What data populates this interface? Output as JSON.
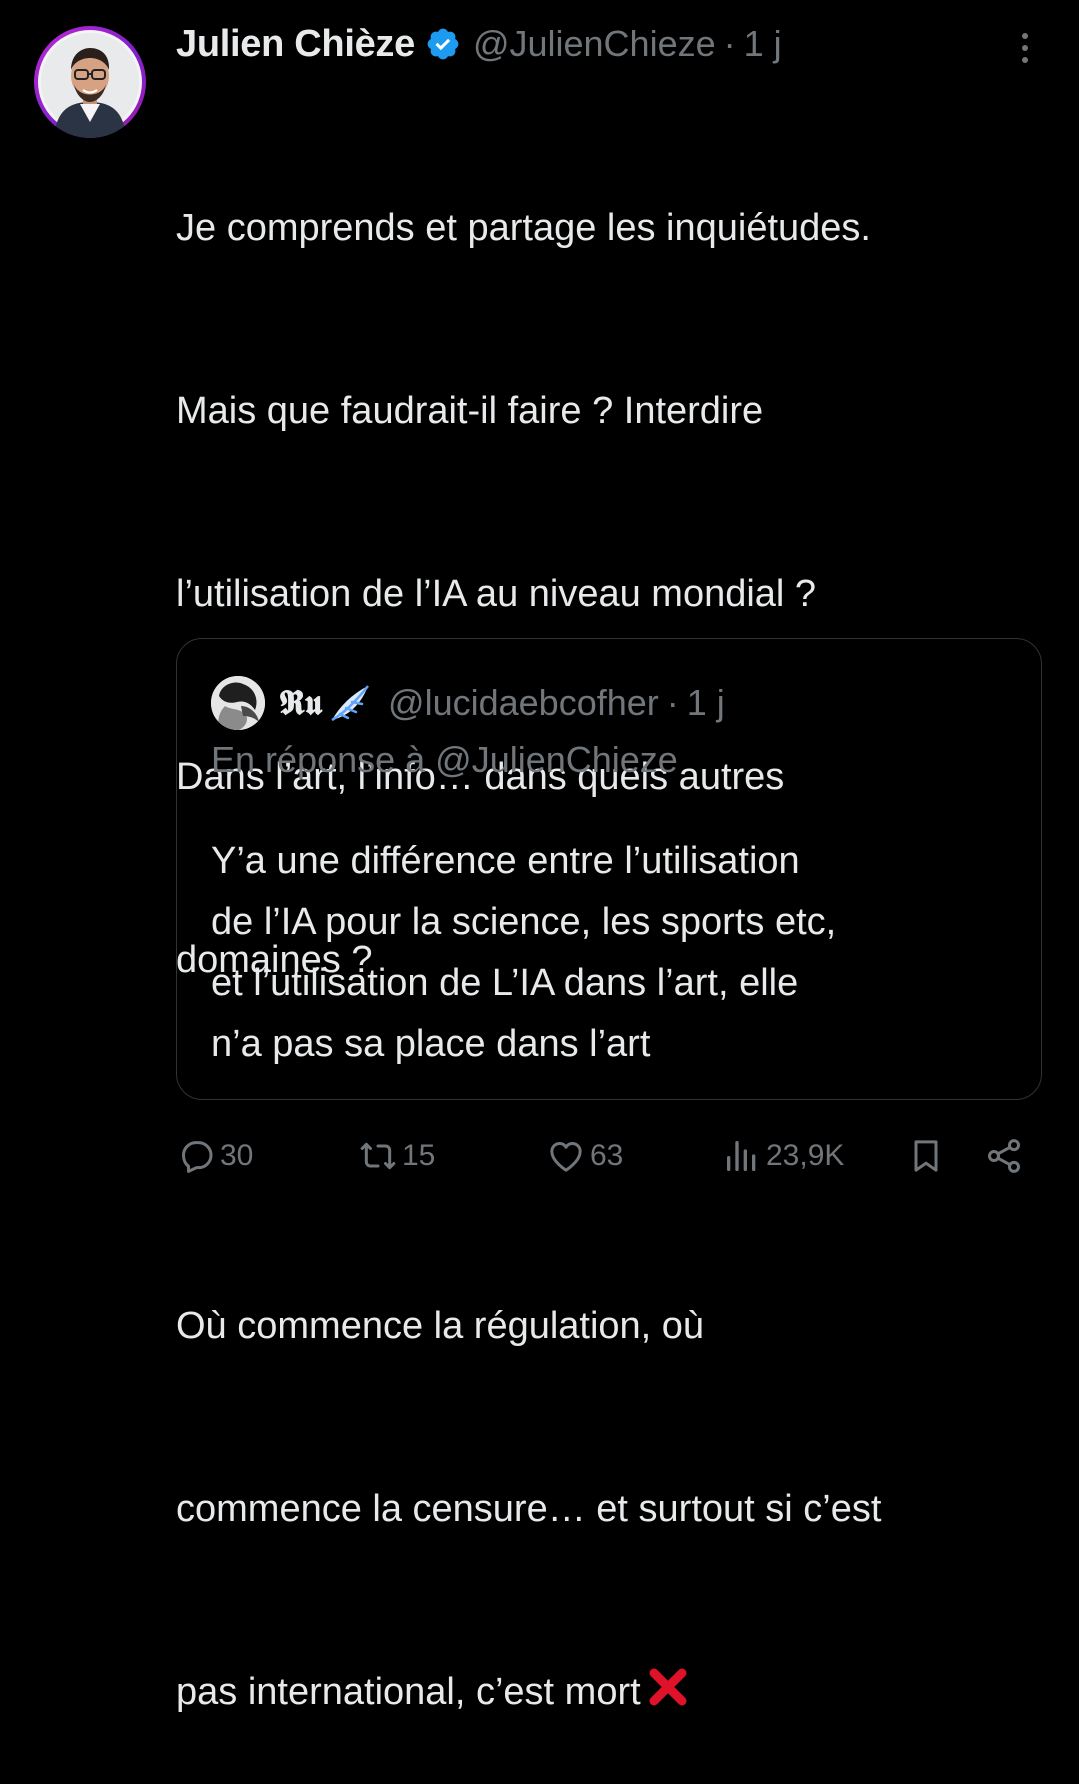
{
  "tweet": {
    "author": {
      "display_name": "Julien Chièze",
      "handle": "@JulienChieze",
      "verified": true,
      "avatar_icon": "profile-photo"
    },
    "separator": "·",
    "time": "1 j",
    "text_lines": [
      "Je comprends et partage les inquiétudes.",
      "Mais que faudrait-il faire ? Interdire",
      "l’utilisation de l’IA au niveau mondial ?",
      "Dans l’art, l’info… dans quels autres",
      "domaines ?",
      "",
      "Où commence la régulation, où",
      "commence la censure… et surtout si c’est",
      "pas international, c’est mort"
    ],
    "end_emoji": "cross-mark-icon"
  },
  "quote": {
    "author": {
      "display_name": "𝕽𝖚",
      "name_emoji": "wing-icon",
      "handle": "@lucidaebcofher"
    },
    "separator": "·",
    "time": "1 j",
    "reply_to": "En réponse à @JulienChieze",
    "text_lines": [
      "Y’a une différence entre l’utilisation",
      "de l’IA pour la science, les sports etc,",
      "et l’utilisation de L’IA dans l’art, elle",
      "n’a pas sa place dans l’art"
    ]
  },
  "actions": {
    "replies": "30",
    "reposts": "15",
    "likes": "63",
    "views": "23,9K"
  },
  "colors": {
    "background": "#000000",
    "text": "#e7e9ea",
    "muted": "#71767b",
    "border": "#2f3336",
    "verified": "#1d9bf0",
    "cross": "#e0122a"
  }
}
